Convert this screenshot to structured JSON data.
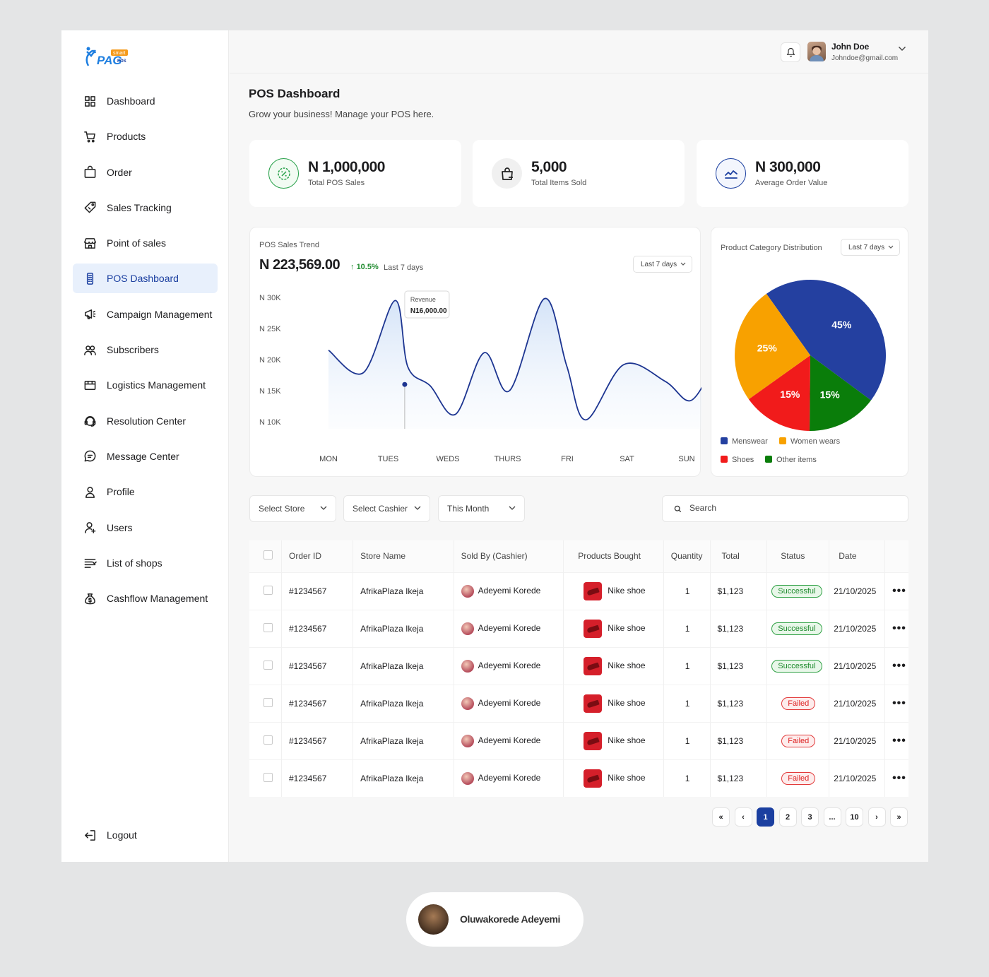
{
  "sidebar": {
    "logo": {
      "text": "PAG",
      "badge": "smart",
      "sub": "POS"
    },
    "items": [
      {
        "label": "Dashboard",
        "icon": "grid-icon"
      },
      {
        "label": "Products",
        "icon": "cart-icon"
      },
      {
        "label": "Order",
        "icon": "bag-icon"
      },
      {
        "label": "Sales Tracking",
        "icon": "tag-icon"
      },
      {
        "label": "Point of sales",
        "icon": "store-icon"
      },
      {
        "label": "POS Dashboard",
        "icon": "pos-device-icon",
        "active": true
      },
      {
        "label": "Campaign Management",
        "icon": "megaphone-icon"
      },
      {
        "label": "Subscribers",
        "icon": "users-group-icon"
      },
      {
        "label": "Logistics Management",
        "icon": "truck-box-icon"
      },
      {
        "label": "Resolution Center",
        "icon": "headset-icon"
      },
      {
        "label": "Message Center",
        "icon": "chat-icon"
      },
      {
        "label": "Profile",
        "icon": "user-icon"
      },
      {
        "label": "Users",
        "icon": "user-plus-icon"
      },
      {
        "label": "List of shops",
        "icon": "list-icon"
      },
      {
        "label": "Cashflow Management",
        "icon": "money-bag-icon"
      }
    ],
    "logout": "Logout"
  },
  "header": {
    "user_name": "John Doe",
    "user_email": "Johndoe@gmail.com"
  },
  "page": {
    "title": "POS Dashboard",
    "subtitle": "Grow your business! Manage your POS here."
  },
  "stats": [
    {
      "value": "N 1,000,000",
      "label": "Total POS Sales",
      "icon": "percent-icon"
    },
    {
      "value": "5,000",
      "label": "Total Items Sold",
      "icon": "shopping-bag-icon"
    },
    {
      "value": "N 300,000",
      "label": "Average Order Value",
      "icon": "trend-icon"
    }
  ],
  "trend": {
    "title": "POS Sales Trend",
    "total": "N 223,569.00",
    "change": "10.5%",
    "period": "Last 7 days",
    "range": "Last 7 days",
    "tooltip_label": "Revenue",
    "tooltip_value": "N16,000.00"
  },
  "pie": {
    "title": "Product Category Distribution",
    "range": "Last 7 days"
  },
  "chart_data": [
    {
      "type": "line",
      "title": "POS Sales Trend",
      "x": [
        "MON",
        "TUES",
        "WEDS",
        "THURS",
        "FRI",
        "SAT",
        "SUN"
      ],
      "y_ticks": [
        "N 30K",
        "N 25K",
        "N 20K",
        "N 15K",
        "N 10K"
      ],
      "ylim": [
        10000,
        30000
      ],
      "series_points": [
        [
          0.0,
          21500
        ],
        [
          0.55,
          17900
        ],
        [
          1.05,
          29500
        ],
        [
          1.25,
          18800
        ],
        [
          1.6,
          15800
        ],
        [
          2.0,
          11200
        ],
        [
          2.45,
          21100
        ],
        [
          2.85,
          15000
        ],
        [
          3.4,
          29800
        ],
        [
          3.75,
          19000
        ],
        [
          4.05,
          10300
        ],
        [
          4.65,
          19200
        ],
        [
          5.3,
          16500
        ],
        [
          5.7,
          13400
        ],
        [
          6.05,
          18800
        ]
      ],
      "highlight": {
        "x_index": 1.2,
        "value": 16000
      }
    },
    {
      "type": "pie",
      "title": "Product Category Distribution",
      "labels": [
        "Menswear",
        "Other items",
        "Shoes",
        "Women wears"
      ],
      "values": [
        45,
        15,
        15,
        25
      ],
      "colors": [
        "#2440a0",
        "#0a7d0a",
        "#f11b1b",
        "#f8a100"
      ],
      "legend": "bottom"
    }
  ],
  "filters": {
    "store": "Select Store",
    "cashier": "Select Cashier",
    "period": "This Month",
    "search_placeholder": "Search"
  },
  "table": {
    "columns": [
      "Order ID",
      "Store Name",
      "Sold By (Cashier)",
      "Products Bought",
      "Quantity",
      "Total",
      "Status",
      "Date"
    ],
    "rows": [
      {
        "id": "#1234567",
        "store": "AfrikaPlaza Ikeja",
        "cashier": "Adeyemi Korede",
        "product": "Nike shoe",
        "qty": "1",
        "total": "$1,123",
        "status": "Successful",
        "date": "21/10/2025"
      },
      {
        "id": "#1234567",
        "store": "AfrikaPlaza Ikeja",
        "cashier": "Adeyemi Korede",
        "product": "Nike shoe",
        "qty": "1",
        "total": "$1,123",
        "status": "Successful",
        "date": "21/10/2025"
      },
      {
        "id": "#1234567",
        "store": "AfrikaPlaza Ikeja",
        "cashier": "Adeyemi Korede",
        "product": "Nike shoe",
        "qty": "1",
        "total": "$1,123",
        "status": "Successful",
        "date": "21/10/2025"
      },
      {
        "id": "#1234567",
        "store": "AfrikaPlaza Ikeja",
        "cashier": "Adeyemi Korede",
        "product": "Nike shoe",
        "qty": "1",
        "total": "$1,123",
        "status": "Failed",
        "date": "21/10/2025"
      },
      {
        "id": "#1234567",
        "store": "AfrikaPlaza Ikeja",
        "cashier": "Adeyemi Korede",
        "product": "Nike shoe",
        "qty": "1",
        "total": "$1,123",
        "status": "Failed",
        "date": "21/10/2025"
      },
      {
        "id": "#1234567",
        "store": "AfrikaPlaza Ikeja",
        "cashier": "Adeyemi Korede",
        "product": "Nike shoe",
        "qty": "1",
        "total": "$1,123",
        "status": "Failed",
        "date": "21/10/2025"
      }
    ],
    "row_action": "•••"
  },
  "pagination": {
    "first": "«",
    "prev": "‹",
    "pages": [
      "1",
      "2",
      "3",
      "...",
      "10"
    ],
    "current": "1",
    "next": "›",
    "last": "»"
  },
  "author": {
    "name": "Oluwakorede Adeyemi"
  },
  "colors": {
    "primary": "#1b3fa0",
    "success": "#1e8a2d",
    "danger": "#e23b3b",
    "up": "#1e8a2d"
  }
}
